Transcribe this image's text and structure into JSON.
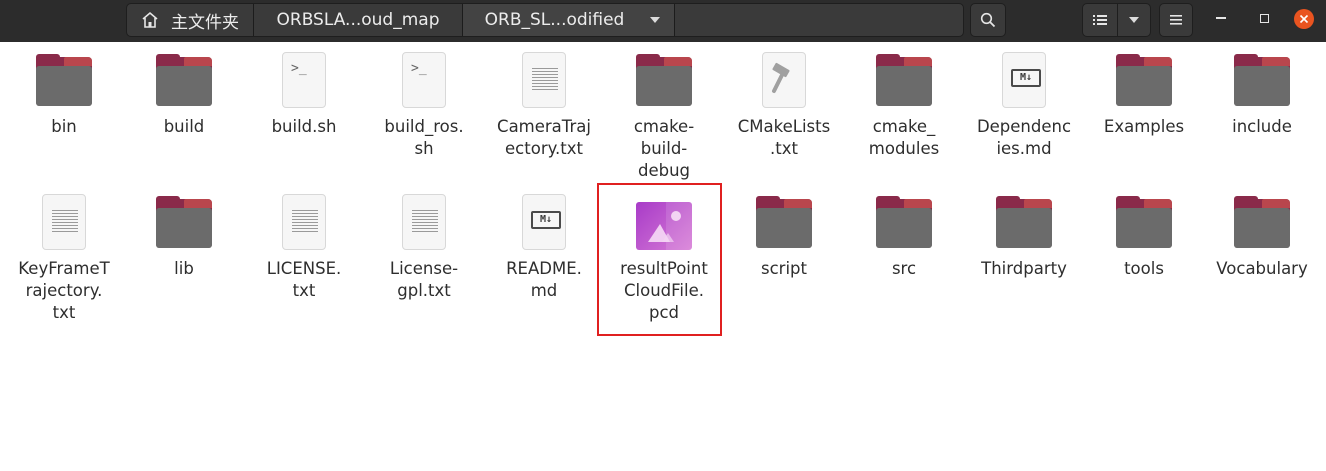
{
  "header": {
    "breadcrumbs": [
      {
        "label": "主文件夹",
        "icon": "home-icon"
      },
      {
        "label": "ORBSLA...oud_map"
      },
      {
        "label": "ORB_SL...odified"
      }
    ],
    "buttons": [
      "search-icon",
      "list-view-icon",
      "chevron-down-icon",
      "menu-icon",
      "minimize-icon",
      "maximize-icon",
      "close-icon"
    ],
    "colors": {
      "header_bg": "#2c2c2c",
      "close": "#e95420",
      "folder_tab": "#8a2a4a",
      "folder_body": "#6b6b6b",
      "highlight": "#e02020"
    }
  },
  "files": [
    {
      "name": "bin",
      "type": "folder"
    },
    {
      "name": "build",
      "type": "folder"
    },
    {
      "name": "build.sh",
      "type": "script"
    },
    {
      "name": "build_ros.sh",
      "type": "script"
    },
    {
      "name": "CameraTrajectory.txt",
      "type": "text"
    },
    {
      "name": "cmake-build-debug",
      "type": "folder"
    },
    {
      "name": "CMakeLists.txt",
      "type": "cmake"
    },
    {
      "name": "cmake_modules",
      "type": "folder"
    },
    {
      "name": "Dependencies.md",
      "type": "markdown"
    },
    {
      "name": "Examples",
      "type": "folder"
    },
    {
      "name": "include",
      "type": "folder"
    },
    {
      "name": "KeyFrameTrajectory.txt",
      "type": "text"
    },
    {
      "name": "lib",
      "type": "folder"
    },
    {
      "name": "LICENSE.txt",
      "type": "text"
    },
    {
      "name": "License-gpl.txt",
      "type": "text"
    },
    {
      "name": "README.md",
      "type": "markdown"
    },
    {
      "name": "resultPointCloudFile.pcd",
      "type": "image",
      "highlighted": true
    },
    {
      "name": "script",
      "type": "folder"
    },
    {
      "name": "src",
      "type": "folder"
    },
    {
      "name": "Thirdparty",
      "type": "folder"
    },
    {
      "name": "tools",
      "type": "folder"
    },
    {
      "name": "Vocabulary",
      "type": "folder"
    }
  ],
  "labels": {
    "bin": "bin",
    "build": "build",
    "build_sh": "build.sh",
    "build_ros_sh": "build_ros.\nsh",
    "camera_traj": "CameraTraj\nectory.txt",
    "cmake_build_debug": "cmake-\nbuild-\ndebug",
    "cmakelists": "CMakeLists\n.txt",
    "cmake_modules": "cmake_\nmodules",
    "dependencies": "Dependenc\nies.md",
    "examples": "Examples",
    "include": "include",
    "keyframe": "KeyFrameT\nrajectory.\ntxt",
    "lib": "lib",
    "license": "LICENSE.\ntxt",
    "license_gpl": "License-\ngpl.txt",
    "readme": "README.\nmd",
    "result_pcd": "resultPoint\nCloudFile.\npcd",
    "script": "script",
    "src": "src",
    "thirdparty": "Thirdparty",
    "tools": "tools",
    "vocabulary": "Vocabulary"
  }
}
